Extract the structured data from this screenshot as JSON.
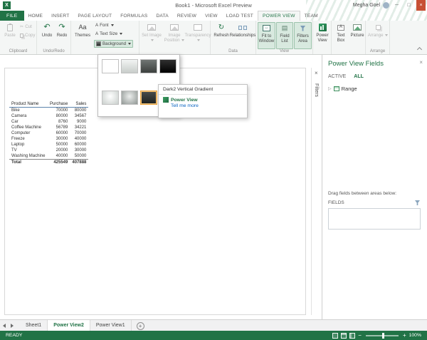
{
  "window": {
    "title": "Book1 - Microsoft Excel Preview",
    "user_name": "Megha Goel"
  },
  "icons": {
    "cut": "✂",
    "undo": "↶",
    "redo": "↷",
    "refresh": "↻",
    "field_list_glyph": "▤",
    "themes_glyph": "Aa",
    "font_glyph": "A",
    "text_box_glyph": "A",
    "fit_arrows": "↔",
    "close": "×",
    "minimize": "─",
    "maximize": "□",
    "zoom_minus": "−",
    "zoom_plus": "+",
    "add_sheet": "+",
    "expand_triangle": "▷"
  },
  "accent_color": "#217346",
  "tabs": {
    "file": "FILE",
    "items": [
      "HOME",
      "INSERT",
      "PAGE LAYOUT",
      "FORMULAS",
      "DATA",
      "REVIEW",
      "VIEW",
      "LOAD TEST",
      "POWER VIEW",
      "TEAM"
    ],
    "active": "POWER VIEW"
  },
  "ribbon": {
    "clipboard": {
      "label": "Clipboard",
      "paste": "Paste",
      "cut": "Cut",
      "copy": "Copy"
    },
    "undo_redo": {
      "label": "Undo/Redo",
      "undo": "Undo",
      "redo": "Redo"
    },
    "themes": {
      "themes": "Themes",
      "font": "Font",
      "text_size": "Text Size",
      "background": "Background"
    },
    "picture_group": {
      "set_image": "Set Image",
      "image_position": "Image Position",
      "transparency": "Transparency"
    },
    "data": {
      "label": "Data",
      "refresh": "Refresh",
      "relationships": "Relationships"
    },
    "view": {
      "label": "View",
      "fit": "Fit to Window",
      "field_list": "Field List",
      "filters_area": "Filters Area"
    },
    "power_view": {
      "power_view": "Power View"
    },
    "insert": {
      "text_box": "Text Box",
      "picture": "Picture"
    },
    "arrange": {
      "label": "Arrange",
      "arrange": "Arrange"
    }
  },
  "gallery": {
    "tooltip_title": "Dark2 Vertical Gradient",
    "help_title": "Power View",
    "help_link": "Tell me more",
    "swatches": [
      {
        "css": "#ffffff"
      },
      {
        "css": "linear-gradient(#f2f4f3,#c8cdca)"
      },
      {
        "css": "linear-gradient(#707573,#3c403e)"
      },
      {
        "css": "linear-gradient(#303030,#000000)"
      },
      {
        "css": "radial-gradient(circle at 50% 40%, #ffffff 0%, #c9cfcc 100%)"
      },
      {
        "css": "radial-gradient(circle at 50% 40%, #eceeed 0%, #8f9693 100%)"
      },
      {
        "css": "linear-gradient(#4a4e4c,#1e2220)",
        "hover": true
      },
      {
        "css": "linear-gradient(#262626,#050505)"
      }
    ]
  },
  "canvas": {
    "filters_label": "Filters",
    "table": {
      "headers": [
        "Product Name",
        "Purchase",
        "Sales"
      ],
      "rows": [
        [
          "Bike",
          "70000",
          "80000"
        ],
        [
          "Camera",
          "80000",
          "34567"
        ],
        [
          "Car",
          "8760",
          "9000"
        ],
        [
          "Coffee Machine",
          "56789",
          "34221"
        ],
        [
          "Computer",
          "60000",
          "70000"
        ],
        [
          "Freeze",
          "30000",
          "40000"
        ],
        [
          "Laptop",
          "50000",
          "60000"
        ],
        [
          "TV",
          "20000",
          "30000"
        ],
        [
          "Washing Machine",
          "40000",
          "50000"
        ]
      ],
      "total": [
        "Total",
        "425549",
        "407888"
      ]
    }
  },
  "fields_panel": {
    "title": "Power View Fields",
    "tab_active": "ACTIVE",
    "tab_all": "ALL",
    "field": "Range",
    "drag_hint": "Drag fields between areas below:",
    "fields_label": "FIELDS"
  },
  "sheet_bar": {
    "sheets": [
      "Sheet1",
      "Power View2",
      "Power View1"
    ],
    "active": "Power View2"
  },
  "status_bar": {
    "ready": "READY",
    "zoom": "100%"
  }
}
